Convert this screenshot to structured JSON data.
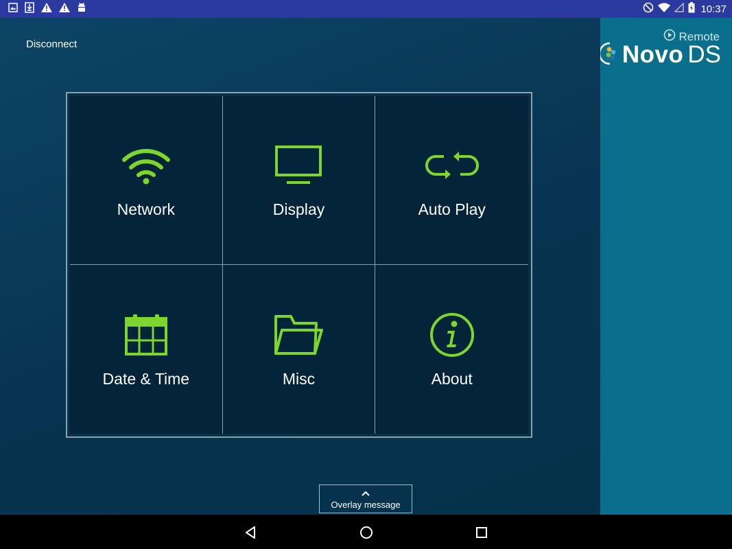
{
  "status_bar": {
    "time": "10:37",
    "left_icons": [
      "image-icon",
      "download-icon",
      "warning-icon",
      "warning-icon",
      "android-icon"
    ],
    "right_icons": [
      "do-not-disturb-icon",
      "wifi-icon",
      "signal-icon",
      "battery-icon"
    ]
  },
  "main": {
    "disconnect_label": "Disconnect",
    "tiles": [
      {
        "label": "Network",
        "icon": "wifi-icon"
      },
      {
        "label": "Display",
        "icon": "monitor-icon"
      },
      {
        "label": "Auto Play",
        "icon": "repeat-icon"
      },
      {
        "label": "Date & Time",
        "icon": "calendar-icon"
      },
      {
        "label": "Misc",
        "icon": "folder-icon"
      },
      {
        "label": "About",
        "icon": "info-icon"
      }
    ],
    "overlay_label": "Overlay message"
  },
  "brand": {
    "remote": "Remote",
    "novo": "Novo",
    "ds": "DS"
  },
  "colors": {
    "accent_green": "#7dd62d",
    "status_bar": "#2a3aa1",
    "side_panel": "#0a6f8c",
    "tile_bg": "#032439"
  },
  "nav": [
    "back-icon",
    "home-icon",
    "recents-icon"
  ]
}
